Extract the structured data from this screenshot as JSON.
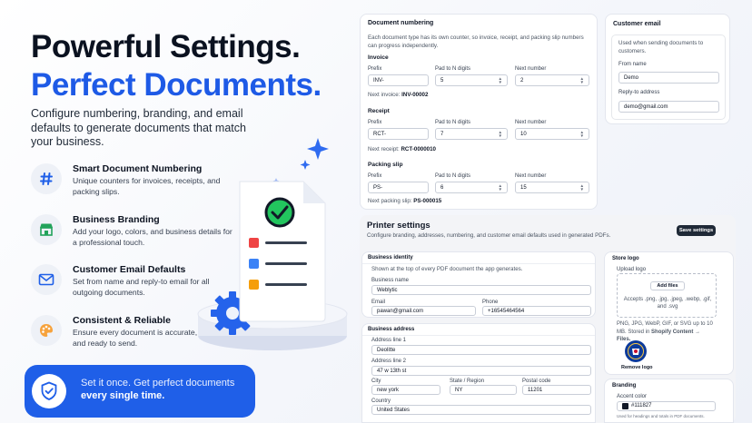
{
  "hero": {
    "title_line1": "Powerful Settings.",
    "title_line2": "Perfect Documents.",
    "subtitle": "Configure numbering, branding, and email defaults to generate documents that match your business."
  },
  "features": [
    {
      "icon": "hash-icon",
      "title": "Smart Document Numbering",
      "desc": "Unique counters for invoices, receipts, and packing slips."
    },
    {
      "icon": "store-icon",
      "title": "Business Branding",
      "desc": "Add your logo, colors, and business details for a professional touch."
    },
    {
      "icon": "mail-icon",
      "title": "Customer Email Defaults",
      "desc": "Set from name and reply-to email for all outgoing documents."
    },
    {
      "icon": "palette-icon",
      "title": "Consistent & Reliable",
      "desc": "Ensure every document is accurate, branded, and ready to send."
    }
  ],
  "cta": {
    "line1": "Set it once. Get perfect documents",
    "line2": "every single time."
  },
  "numbering": {
    "title": "Document numbering",
    "desc": "Each document type has its own counter, so invoice, receipt, and packing slip numbers can progress independently.",
    "prefix_label": "Prefix",
    "pad_label": "Pad to N digits",
    "next_label": "Next number",
    "groups": [
      {
        "name": "Invoice",
        "prefix": "INV-",
        "pad": "5",
        "next": "2",
        "preview_label": "Next invoice:",
        "preview_value": "INV-00002"
      },
      {
        "name": "Receipt",
        "prefix": "RCT-",
        "pad": "7",
        "next": "10",
        "preview_label": "Next receipt:",
        "preview_value": "RCT-0000010"
      },
      {
        "name": "Packing slip",
        "prefix": "PS-",
        "pad": "6",
        "next": "15",
        "preview_label": "Next packing slip:",
        "preview_value": "PS-000015"
      }
    ]
  },
  "customer_email": {
    "title": "Customer email",
    "desc": "Used when sending documents to customers.",
    "from_label": "From name",
    "from_value": "Demo",
    "reply_label": "Reply-to address",
    "reply_value": "demo@gmail.com"
  },
  "printer": {
    "title": "Printer settings",
    "desc": "Configure branding, addresses, numbering, and customer email defaults used in generated PDFs.",
    "save_label": "Save settings"
  },
  "business_identity": {
    "title": "Business identity",
    "desc": "Shown at the top of every PDF document the app generates.",
    "name_label": "Business name",
    "name_value": "Weblytic",
    "email_label": "Email",
    "email_value": "pawan@gmail.com",
    "phone_label": "Phone",
    "phone_value": "+16545464564"
  },
  "business_address": {
    "title": "Business address",
    "line1_label": "Address line 1",
    "line1_value": "Deolitte",
    "line2_label": "Address line 2",
    "line2_value": "47 w 13th st",
    "city_label": "City",
    "city_value": "new york",
    "state_label": "State / Region",
    "state_value": "NY",
    "postal_label": "Postal code",
    "postal_value": "11201",
    "country_label": "Country",
    "country_value": "United States"
  },
  "store_logo": {
    "title": "Store logo",
    "upload_label": "Upload logo",
    "add_files": "Add files",
    "accepts": "Accepts .png, .jpg, .jpeg, .webp, .gif, and .svg",
    "help_text": "PNG, JPG, WebP, GIF, or SVG up to 10 MB. Stored in",
    "help_bold": "Shopify Content → Files.",
    "remove": "Remove logo"
  },
  "branding": {
    "title": "Branding",
    "accent_label": "Accent color",
    "accent_value": "#111827",
    "accent_help": "Used for headings and totals in PDF documents."
  },
  "colors": {
    "brand_blue": "#1f5fe8",
    "accent": "#111827",
    "check_green": "#16a34a"
  }
}
